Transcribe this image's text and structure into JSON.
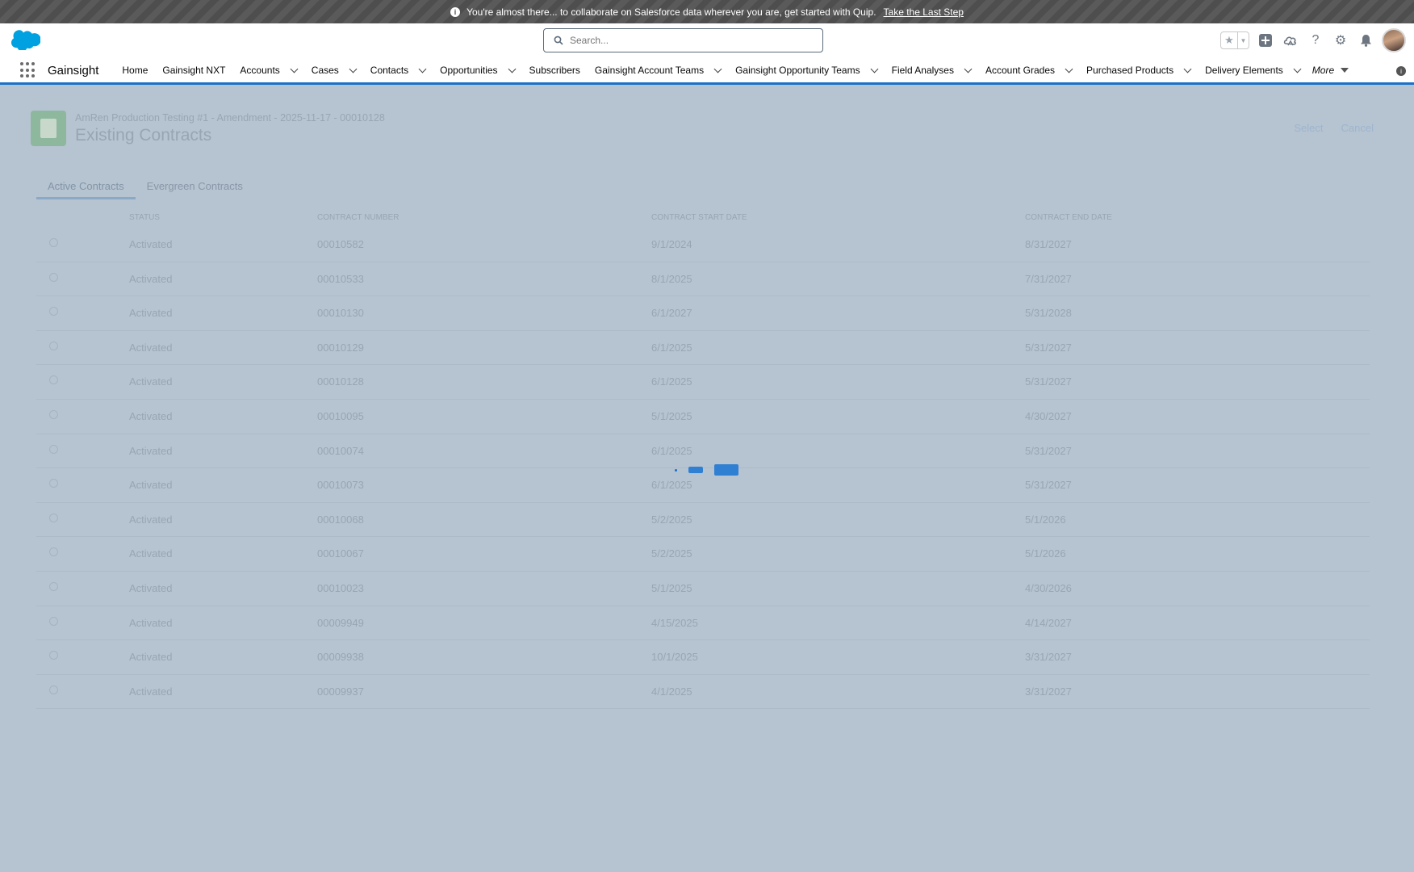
{
  "banner": {
    "message": "You're almost there... to collaborate on Salesforce data wherever you are, get started with Quip.",
    "link": "Take the Last Step"
  },
  "header": {
    "search_placeholder": "Search...",
    "icons": [
      "favorites-star-icon",
      "favorites-dropdown-icon",
      "global-add-icon",
      "trailhead-icon",
      "help-icon",
      "setup-gear-icon",
      "notifications-bell-icon",
      "user-avatar"
    ]
  },
  "nav": {
    "app_name": "Gainsight",
    "items": [
      {
        "label": "Home",
        "dropdown": false
      },
      {
        "label": "Gainsight NXT",
        "dropdown": false
      },
      {
        "label": "Accounts",
        "dropdown": true
      },
      {
        "label": "Cases",
        "dropdown": true
      },
      {
        "label": "Contacts",
        "dropdown": true
      },
      {
        "label": "Opportunities",
        "dropdown": true
      },
      {
        "label": "Subscribers",
        "dropdown": false
      },
      {
        "label": "Gainsight Account Teams",
        "dropdown": true
      },
      {
        "label": "Gainsight Opportunity Teams",
        "dropdown": true
      },
      {
        "label": "Field Analyses",
        "dropdown": true
      },
      {
        "label": "Account Grades",
        "dropdown": true
      },
      {
        "label": "Purchased Products",
        "dropdown": true
      },
      {
        "label": "Delivery Elements",
        "dropdown": true
      }
    ],
    "more_label": "More"
  },
  "page": {
    "breadcrumb": "AmRen Production Testing #1 - Amendment - 2025-11-17 - 00010128",
    "title": "Existing Contracts",
    "select_label": "Select",
    "cancel_label": "Cancel",
    "tabs": [
      "Active Contracts",
      "Evergreen Contracts"
    ],
    "columns": [
      "Status",
      "Contract Number",
      "Contract Start Date",
      "Contract End Date"
    ],
    "rows": [
      {
        "status": "Activated",
        "number": "00010582",
        "start": "9/1/2024",
        "end": "8/31/2027"
      },
      {
        "status": "Activated",
        "number": "00010533",
        "start": "8/1/2025",
        "end": "7/31/2027"
      },
      {
        "status": "Activated",
        "number": "00010130",
        "start": "6/1/2027",
        "end": "5/31/2028"
      },
      {
        "status": "Activated",
        "number": "00010129",
        "start": "6/1/2025",
        "end": "5/31/2027"
      },
      {
        "status": "Activated",
        "number": "00010128",
        "start": "6/1/2025",
        "end": "5/31/2027"
      },
      {
        "status": "Activated",
        "number": "00010095",
        "start": "5/1/2025",
        "end": "4/30/2027"
      },
      {
        "status": "Activated",
        "number": "00010074",
        "start": "6/1/2025",
        "end": "5/31/2027"
      },
      {
        "status": "Activated",
        "number": "00010073",
        "start": "6/1/2025",
        "end": "5/31/2027"
      },
      {
        "status": "Activated",
        "number": "00010068",
        "start": "5/2/2025",
        "end": "5/1/2026"
      },
      {
        "status": "Activated",
        "number": "00010067",
        "start": "5/2/2025",
        "end": "5/1/2026"
      },
      {
        "status": "Activated",
        "number": "00010023",
        "start": "5/1/2025",
        "end": "4/30/2026"
      },
      {
        "status": "Activated",
        "number": "00009949",
        "start": "4/15/2025",
        "end": "4/14/2027"
      },
      {
        "status": "Activated",
        "number": "00009938",
        "start": "10/1/2025",
        "end": "3/31/2027"
      },
      {
        "status": "Activated",
        "number": "00009937",
        "start": "4/1/2025",
        "end": "3/31/2027"
      }
    ]
  },
  "colors": {
    "brand_blue": "#1b70c8",
    "overlay": "#b6c3d0",
    "banner": "#4e4e4e"
  }
}
